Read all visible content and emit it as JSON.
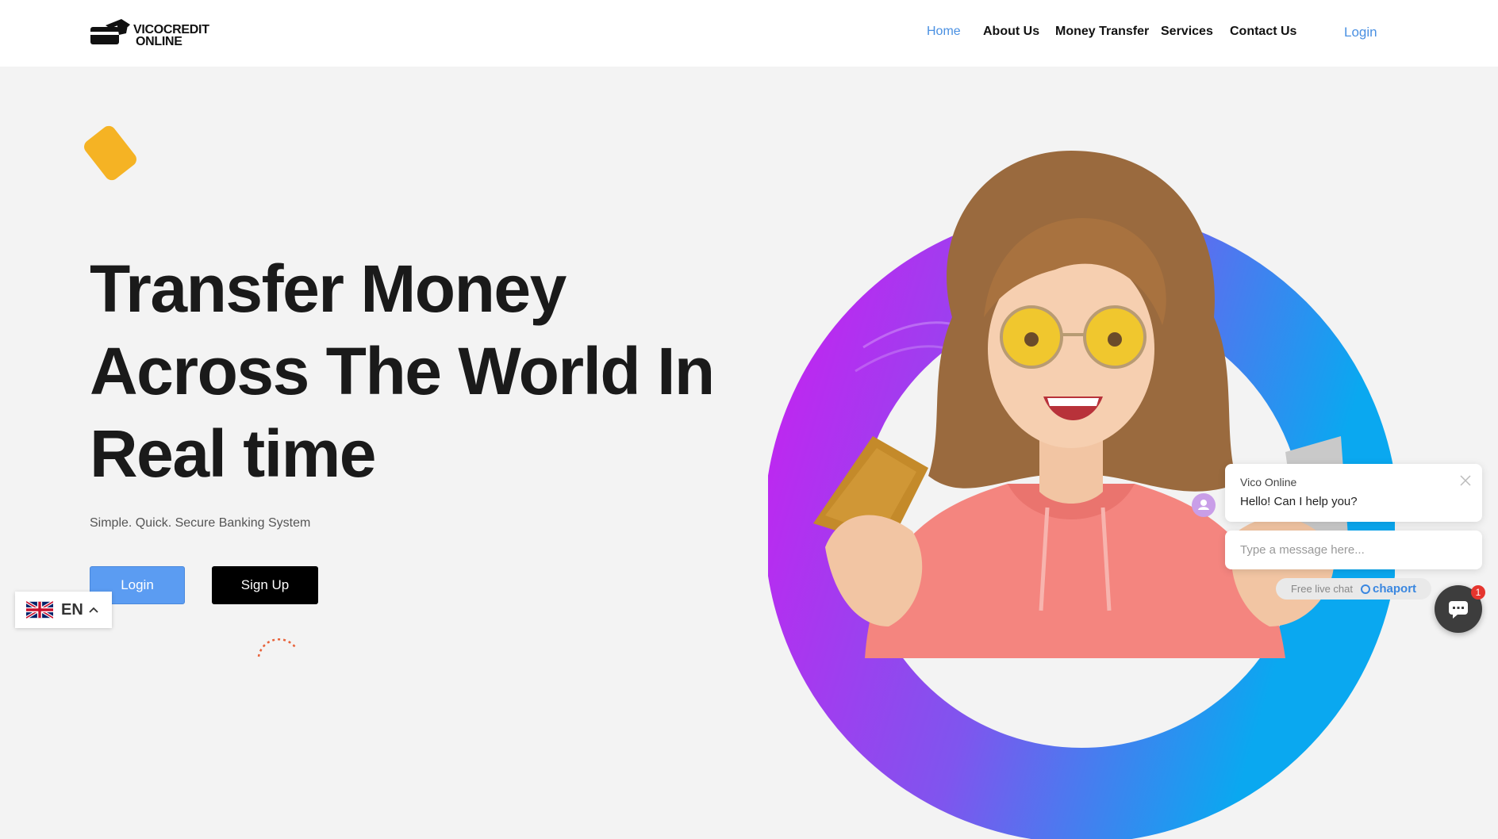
{
  "header": {
    "logo_line1": "VICOCREDIT",
    "logo_line2": "ONLINE",
    "nav": [
      {
        "label": "Home",
        "active": true
      },
      {
        "label": "About Us"
      },
      {
        "label": "Money Transfer"
      },
      {
        "label": "Services"
      },
      {
        "label": "Contact Us"
      }
    ],
    "login_label": "Login"
  },
  "hero": {
    "title_line1": "Transfer Money",
    "title_line2": "Across The World In",
    "title_line3": "Real time",
    "subtitle": "Simple. Quick. Secure Banking System",
    "login_button": "Login",
    "signup_button": "Sign Up"
  },
  "language": {
    "code": "EN",
    "flag_icon": "uk-flag-icon"
  },
  "chat": {
    "agent_name": "Vico Online",
    "message": "Hello! Can I help you?",
    "input_placeholder": "Type a message here...",
    "powered_text": "Free live chat",
    "brand": "chaport",
    "unread_count": "1"
  },
  "colors": {
    "accent": "#4a90e2",
    "button_blue": "#5b9cf2",
    "tag_yellow": "#f5b324",
    "ring_start": "#c026f0",
    "ring_end": "#0aa8f0",
    "hoodie": "#f4857f"
  }
}
